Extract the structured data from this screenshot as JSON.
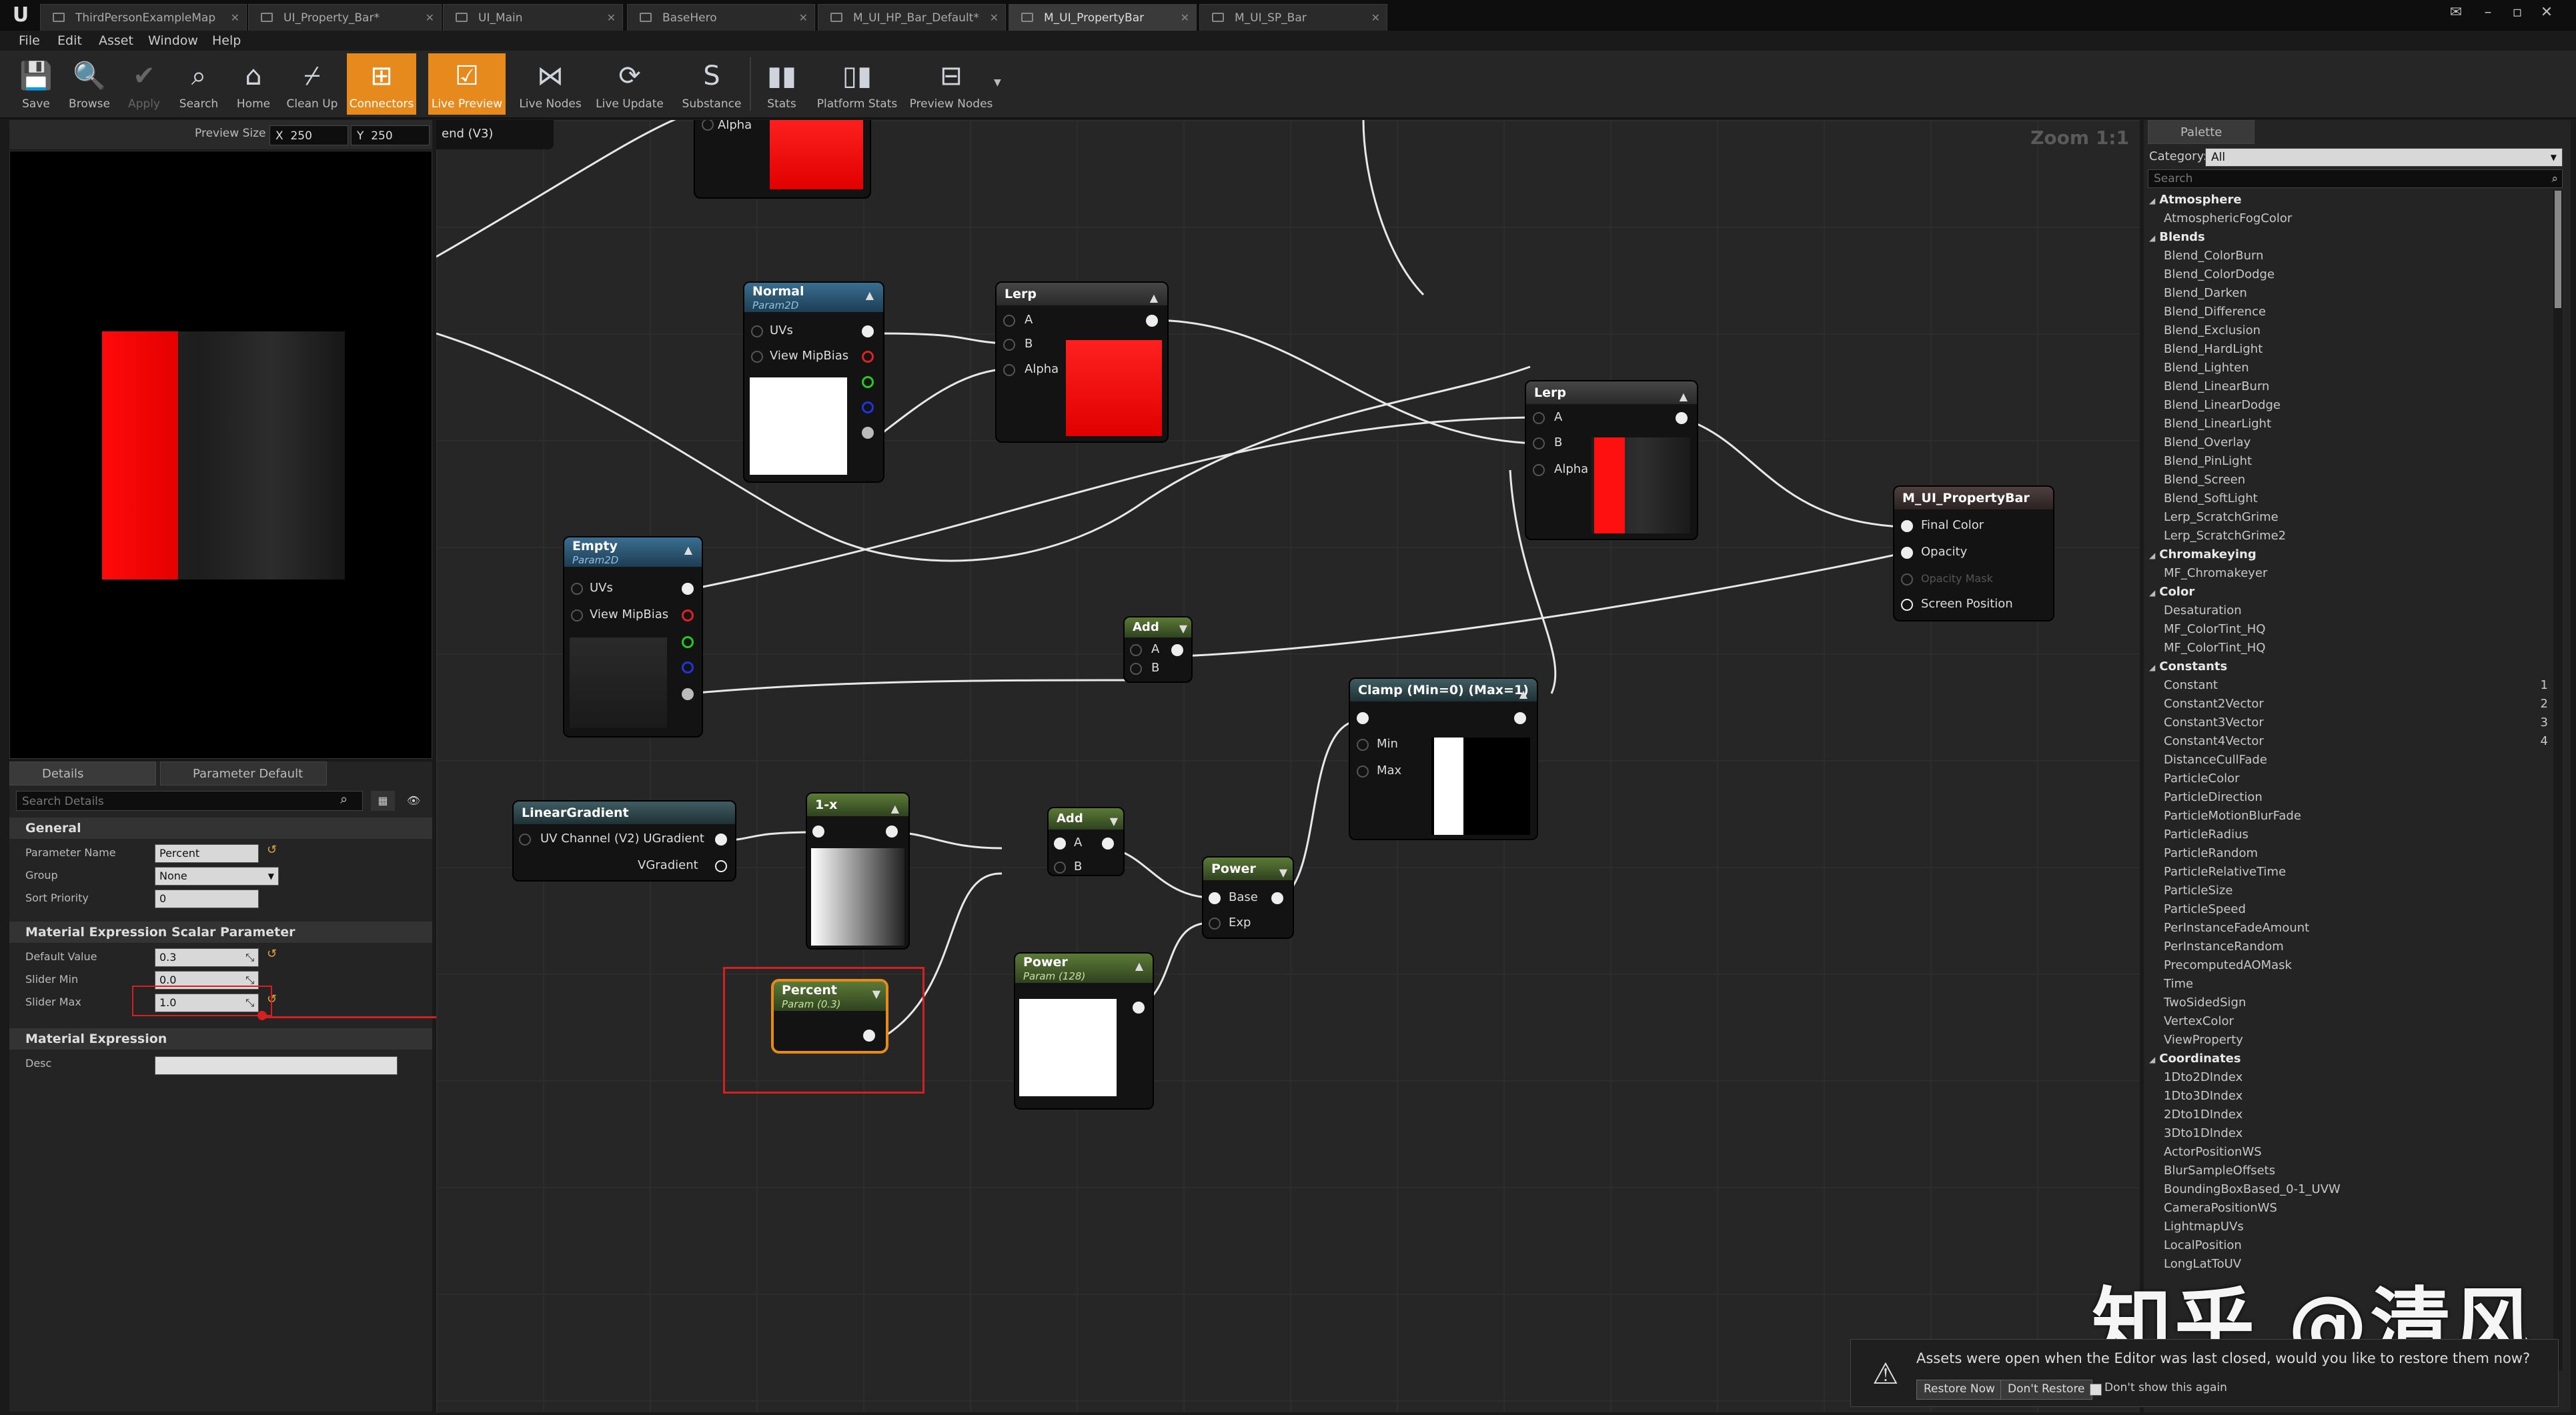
{
  "tabs": [
    {
      "label": "ThirdPersonExampleMap"
    },
    {
      "label": "UI_Property_Bar*"
    },
    {
      "label": "UI_Main"
    },
    {
      "label": "BaseHero"
    },
    {
      "label": "M_UI_HP_Bar_Default*"
    },
    {
      "label": "M_UI_PropertyBar"
    },
    {
      "label": "M_UI_SP_Bar"
    }
  ],
  "menu": [
    "File",
    "Edit",
    "Asset",
    "Window",
    "Help"
  ],
  "toolbar": {
    "save": "Save",
    "browse": "Browse",
    "apply": "Apply",
    "search": "Search",
    "home": "Home",
    "cleanup": "Clean Up",
    "connectors": "Connectors",
    "live_preview": "Live Preview",
    "live_nodes": "Live Nodes",
    "live_update": "Live Update",
    "substance": "Substance",
    "stats": "Stats",
    "platform_stats": "Platform Stats",
    "preview_nodes": "Preview Nodes"
  },
  "preview": {
    "size_label": "Preview Size",
    "x_label": "X",
    "x_value": "250",
    "y_label": "Y",
    "y_value": "250"
  },
  "details": {
    "tab_details": "Details",
    "tab_param_defaults": "Parameter Default",
    "search_placeholder": "Search Details",
    "general": "General",
    "parameter_name_label": "Parameter Name",
    "parameter_name": "Percent",
    "group_label": "Group",
    "group": "None",
    "sort_priority_label": "Sort Priority",
    "sort_priority": "0",
    "scalar_section": "Material Expression Scalar Parameter",
    "default_value_label": "Default Value",
    "default_value": "0.3",
    "slider_min_label": "Slider Min",
    "slider_min": "0.0",
    "slider_max_label": "Slider Max",
    "slider_max": "1.0",
    "expression_section": "Material Expression",
    "desc_label": "Desc"
  },
  "graph": {
    "zoom": "Zoom 1:1",
    "partial_label": "end (V3)",
    "alpha_top": "Alpha",
    "normal": {
      "title": "Normal",
      "sub": "Param2D",
      "uvs": "UVs",
      "mip": "View MipBias"
    },
    "lerp1": {
      "title": "Lerp",
      "a": "A",
      "b": "B",
      "alpha": "Alpha"
    },
    "lerp2": {
      "title": "Lerp",
      "a": "A",
      "b": "B",
      "alpha": "Alpha"
    },
    "output": {
      "title": "M_UI_PropertyBar",
      "final_color": "Final Color",
      "opacity": "Opacity",
      "opacity_mask": "Opacity Mask",
      "screen_position": "Screen Position"
    },
    "empty": {
      "title": "Empty",
      "sub": "Param2D",
      "uvs": "UVs",
      "mip": "View MipBias"
    },
    "add1": {
      "title": "Add",
      "a": "A",
      "b": "B"
    },
    "clamp": {
      "title": "Clamp (Min=0) (Max=1)",
      "min": "Min",
      "max": "Max"
    },
    "linear": {
      "title": "LinearGradient",
      "u": "UV Channel (V2) UGradient",
      "v": "VGradient"
    },
    "oneminus": {
      "title": "1-x"
    },
    "add2": {
      "title": "Add",
      "a": "A",
      "b": "B"
    },
    "power1": {
      "title": "Power",
      "base": "Base",
      "exp": "Exp"
    },
    "percent": {
      "title": "Percent",
      "sub": "Param (0.3)"
    },
    "power2": {
      "title": "Power",
      "sub": "Param (128)"
    }
  },
  "palette": {
    "tab": "Palette",
    "category_label": "Category:",
    "category": "All",
    "search_placeholder": "Search",
    "rows": [
      {
        "t": "c",
        "label": "Atmosphere"
      },
      {
        "t": "i",
        "label": "AtmosphericFogColor"
      },
      {
        "t": "c",
        "label": "Blends"
      },
      {
        "t": "i",
        "label": "Blend_ColorBurn"
      },
      {
        "t": "i",
        "label": "Blend_ColorDodge"
      },
      {
        "t": "i",
        "label": "Blend_Darken"
      },
      {
        "t": "i",
        "label": "Blend_Difference"
      },
      {
        "t": "i",
        "label": "Blend_Exclusion"
      },
      {
        "t": "i",
        "label": "Blend_HardLight"
      },
      {
        "t": "i",
        "label": "Blend_Lighten"
      },
      {
        "t": "i",
        "label": "Blend_LinearBurn"
      },
      {
        "t": "i",
        "label": "Blend_LinearDodge"
      },
      {
        "t": "i",
        "label": "Blend_LinearLight"
      },
      {
        "t": "i",
        "label": "Blend_Overlay"
      },
      {
        "t": "i",
        "label": "Blend_PinLight"
      },
      {
        "t": "i",
        "label": "Blend_Screen"
      },
      {
        "t": "i",
        "label": "Blend_SoftLight"
      },
      {
        "t": "i",
        "label": "Lerp_ScratchGrime"
      },
      {
        "t": "i",
        "label": "Lerp_ScratchGrime2"
      },
      {
        "t": "c",
        "label": "Chromakeying"
      },
      {
        "t": "i",
        "label": "MF_Chromakeyer"
      },
      {
        "t": "c",
        "label": "Color"
      },
      {
        "t": "i",
        "label": "Desaturation"
      },
      {
        "t": "i",
        "label": "MF_ColorTint_HQ"
      },
      {
        "t": "i",
        "label": "MF_ColorTint_HQ"
      },
      {
        "t": "c",
        "label": "Constants"
      },
      {
        "t": "i",
        "label": "Constant",
        "num": "1"
      },
      {
        "t": "i",
        "label": "Constant2Vector",
        "num": "2"
      },
      {
        "t": "i",
        "label": "Constant3Vector",
        "num": "3"
      },
      {
        "t": "i",
        "label": "Constant4Vector",
        "num": "4"
      },
      {
        "t": "i",
        "label": "DistanceCullFade"
      },
      {
        "t": "i",
        "label": "ParticleColor"
      },
      {
        "t": "i",
        "label": "ParticleDirection"
      },
      {
        "t": "i",
        "label": "ParticleMotionBlurFade"
      },
      {
        "t": "i",
        "label": "ParticleRadius"
      },
      {
        "t": "i",
        "label": "ParticleRandom"
      },
      {
        "t": "i",
        "label": "ParticleRelativeTime"
      },
      {
        "t": "i",
        "label": "ParticleSize"
      },
      {
        "t": "i",
        "label": "ParticleSpeed"
      },
      {
        "t": "i",
        "label": "PerInstanceFadeAmount"
      },
      {
        "t": "i",
        "label": "PerInstanceRandom"
      },
      {
        "t": "i",
        "label": "PrecomputedAOMask"
      },
      {
        "t": "i",
        "label": "Time"
      },
      {
        "t": "i",
        "label": "TwoSidedSign"
      },
      {
        "t": "i",
        "label": "VertexColor"
      },
      {
        "t": "i",
        "label": "ViewProperty"
      },
      {
        "t": "c",
        "label": "Coordinates"
      },
      {
        "t": "i",
        "label": "1Dto2DIndex"
      },
      {
        "t": "i",
        "label": "1Dto3DIndex"
      },
      {
        "t": "i",
        "label": "2Dto1DIndex"
      },
      {
        "t": "i",
        "label": "3Dto1DIndex"
      },
      {
        "t": "i",
        "label": "ActorPositionWS"
      },
      {
        "t": "i",
        "label": "BlurSampleOffsets"
      },
      {
        "t": "i",
        "label": "BoundingBoxBased_0-1_UVW"
      },
      {
        "t": "i",
        "label": "CameraPositionWS"
      },
      {
        "t": "i",
        "label": "LightmapUVs"
      },
      {
        "t": "i",
        "label": "LocalPosition"
      },
      {
        "t": "i",
        "label": "LongLatToUV"
      }
    ]
  },
  "toast": {
    "message": "Assets were open when the Editor was last closed, would you like to restore them now?",
    "restore": "Restore Now",
    "dont_restore": "Don't Restore",
    "dont_show": "Don't show this again"
  },
  "watermark": "知乎 @清风",
  "colors": {
    "accent": "#e68a1e",
    "selection": "#d42020",
    "node_green": "#5c7a36",
    "node_blue": "#3a6e90"
  }
}
